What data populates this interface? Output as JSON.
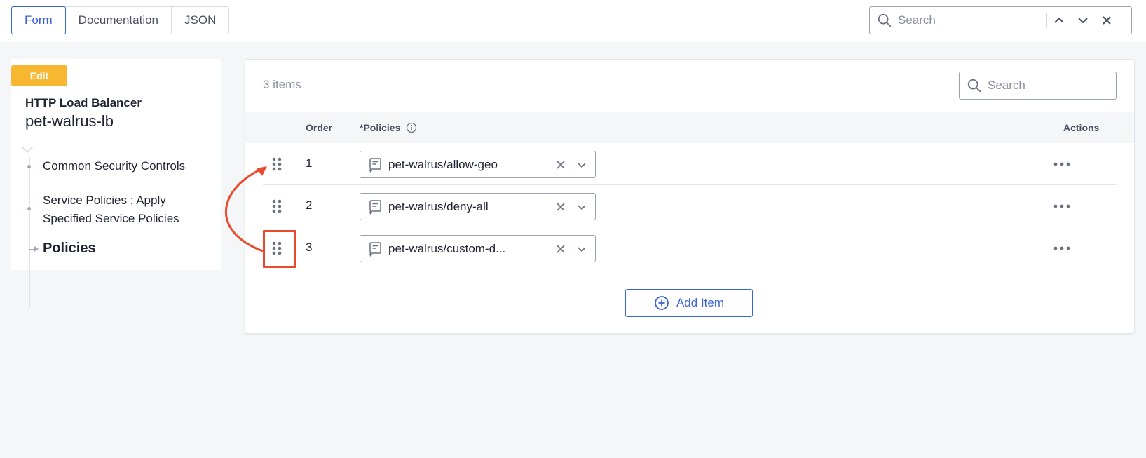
{
  "tabs": [
    {
      "label": "Form",
      "active": true
    },
    {
      "label": "Documentation",
      "active": false
    },
    {
      "label": "JSON",
      "active": false
    }
  ],
  "global_search": {
    "placeholder": "Search"
  },
  "sidebar": {
    "badge": "Edit",
    "object_type": "HTTP Load Balancer",
    "object_name": "pet-walrus-lb",
    "tree": [
      {
        "label": "Common Security Controls"
      },
      {
        "label": "Service Policies : Apply Specified Service Policies"
      },
      {
        "label": "Policies",
        "current": true
      }
    ]
  },
  "table": {
    "count_label": "3 items",
    "search_placeholder": "Search",
    "columns": {
      "order": "Order",
      "policies": "*Policies",
      "actions": "Actions"
    },
    "rows": [
      {
        "order": "1",
        "policy": "pet-walrus/allow-geo"
      },
      {
        "order": "2",
        "policy": "pet-walrus/deny-all"
      },
      {
        "order": "3",
        "policy": "pet-walrus/custom-d..."
      }
    ],
    "add_button": "Add Item"
  },
  "colors": {
    "accent": "#3a63d6",
    "badge": "#f7b731",
    "annotation": "#ea4b2f"
  }
}
